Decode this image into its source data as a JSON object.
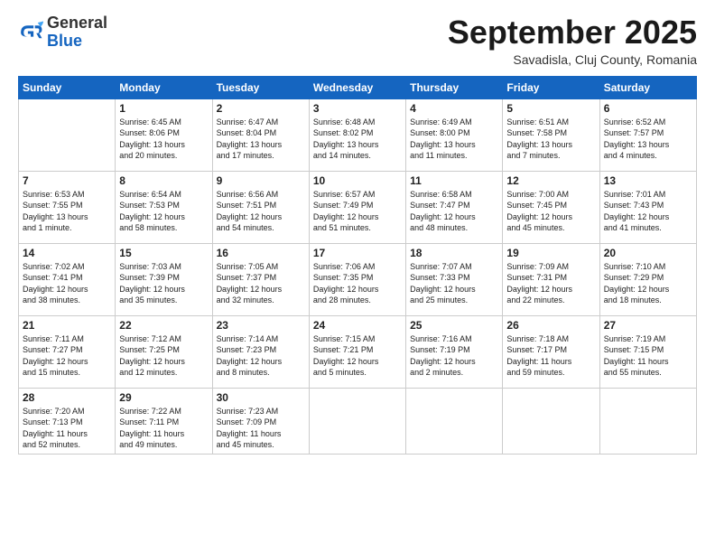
{
  "logo": {
    "general": "General",
    "blue": "Blue"
  },
  "title": "September 2025",
  "location": "Savadisla, Cluj County, Romania",
  "days_of_week": [
    "Sunday",
    "Monday",
    "Tuesday",
    "Wednesday",
    "Thursday",
    "Friday",
    "Saturday"
  ],
  "weeks": [
    [
      {
        "day": "",
        "info": ""
      },
      {
        "day": "1",
        "info": "Sunrise: 6:45 AM\nSunset: 8:06 PM\nDaylight: 13 hours\nand 20 minutes."
      },
      {
        "day": "2",
        "info": "Sunrise: 6:47 AM\nSunset: 8:04 PM\nDaylight: 13 hours\nand 17 minutes."
      },
      {
        "day": "3",
        "info": "Sunrise: 6:48 AM\nSunset: 8:02 PM\nDaylight: 13 hours\nand 14 minutes."
      },
      {
        "day": "4",
        "info": "Sunrise: 6:49 AM\nSunset: 8:00 PM\nDaylight: 13 hours\nand 11 minutes."
      },
      {
        "day": "5",
        "info": "Sunrise: 6:51 AM\nSunset: 7:58 PM\nDaylight: 13 hours\nand 7 minutes."
      },
      {
        "day": "6",
        "info": "Sunrise: 6:52 AM\nSunset: 7:57 PM\nDaylight: 13 hours\nand 4 minutes."
      }
    ],
    [
      {
        "day": "7",
        "info": "Sunrise: 6:53 AM\nSunset: 7:55 PM\nDaylight: 13 hours\nand 1 minute."
      },
      {
        "day": "8",
        "info": "Sunrise: 6:54 AM\nSunset: 7:53 PM\nDaylight: 12 hours\nand 58 minutes."
      },
      {
        "day": "9",
        "info": "Sunrise: 6:56 AM\nSunset: 7:51 PM\nDaylight: 12 hours\nand 54 minutes."
      },
      {
        "day": "10",
        "info": "Sunrise: 6:57 AM\nSunset: 7:49 PM\nDaylight: 12 hours\nand 51 minutes."
      },
      {
        "day": "11",
        "info": "Sunrise: 6:58 AM\nSunset: 7:47 PM\nDaylight: 12 hours\nand 48 minutes."
      },
      {
        "day": "12",
        "info": "Sunrise: 7:00 AM\nSunset: 7:45 PM\nDaylight: 12 hours\nand 45 minutes."
      },
      {
        "day": "13",
        "info": "Sunrise: 7:01 AM\nSunset: 7:43 PM\nDaylight: 12 hours\nand 41 minutes."
      }
    ],
    [
      {
        "day": "14",
        "info": "Sunrise: 7:02 AM\nSunset: 7:41 PM\nDaylight: 12 hours\nand 38 minutes."
      },
      {
        "day": "15",
        "info": "Sunrise: 7:03 AM\nSunset: 7:39 PM\nDaylight: 12 hours\nand 35 minutes."
      },
      {
        "day": "16",
        "info": "Sunrise: 7:05 AM\nSunset: 7:37 PM\nDaylight: 12 hours\nand 32 minutes."
      },
      {
        "day": "17",
        "info": "Sunrise: 7:06 AM\nSunset: 7:35 PM\nDaylight: 12 hours\nand 28 minutes."
      },
      {
        "day": "18",
        "info": "Sunrise: 7:07 AM\nSunset: 7:33 PM\nDaylight: 12 hours\nand 25 minutes."
      },
      {
        "day": "19",
        "info": "Sunrise: 7:09 AM\nSunset: 7:31 PM\nDaylight: 12 hours\nand 22 minutes."
      },
      {
        "day": "20",
        "info": "Sunrise: 7:10 AM\nSunset: 7:29 PM\nDaylight: 12 hours\nand 18 minutes."
      }
    ],
    [
      {
        "day": "21",
        "info": "Sunrise: 7:11 AM\nSunset: 7:27 PM\nDaylight: 12 hours\nand 15 minutes."
      },
      {
        "day": "22",
        "info": "Sunrise: 7:12 AM\nSunset: 7:25 PM\nDaylight: 12 hours\nand 12 minutes."
      },
      {
        "day": "23",
        "info": "Sunrise: 7:14 AM\nSunset: 7:23 PM\nDaylight: 12 hours\nand 8 minutes."
      },
      {
        "day": "24",
        "info": "Sunrise: 7:15 AM\nSunset: 7:21 PM\nDaylight: 12 hours\nand 5 minutes."
      },
      {
        "day": "25",
        "info": "Sunrise: 7:16 AM\nSunset: 7:19 PM\nDaylight: 12 hours\nand 2 minutes."
      },
      {
        "day": "26",
        "info": "Sunrise: 7:18 AM\nSunset: 7:17 PM\nDaylight: 11 hours\nand 59 minutes."
      },
      {
        "day": "27",
        "info": "Sunrise: 7:19 AM\nSunset: 7:15 PM\nDaylight: 11 hours\nand 55 minutes."
      }
    ],
    [
      {
        "day": "28",
        "info": "Sunrise: 7:20 AM\nSunset: 7:13 PM\nDaylight: 11 hours\nand 52 minutes."
      },
      {
        "day": "29",
        "info": "Sunrise: 7:22 AM\nSunset: 7:11 PM\nDaylight: 11 hours\nand 49 minutes."
      },
      {
        "day": "30",
        "info": "Sunrise: 7:23 AM\nSunset: 7:09 PM\nDaylight: 11 hours\nand 45 minutes."
      },
      {
        "day": "",
        "info": ""
      },
      {
        "day": "",
        "info": ""
      },
      {
        "day": "",
        "info": ""
      },
      {
        "day": "",
        "info": ""
      }
    ]
  ]
}
